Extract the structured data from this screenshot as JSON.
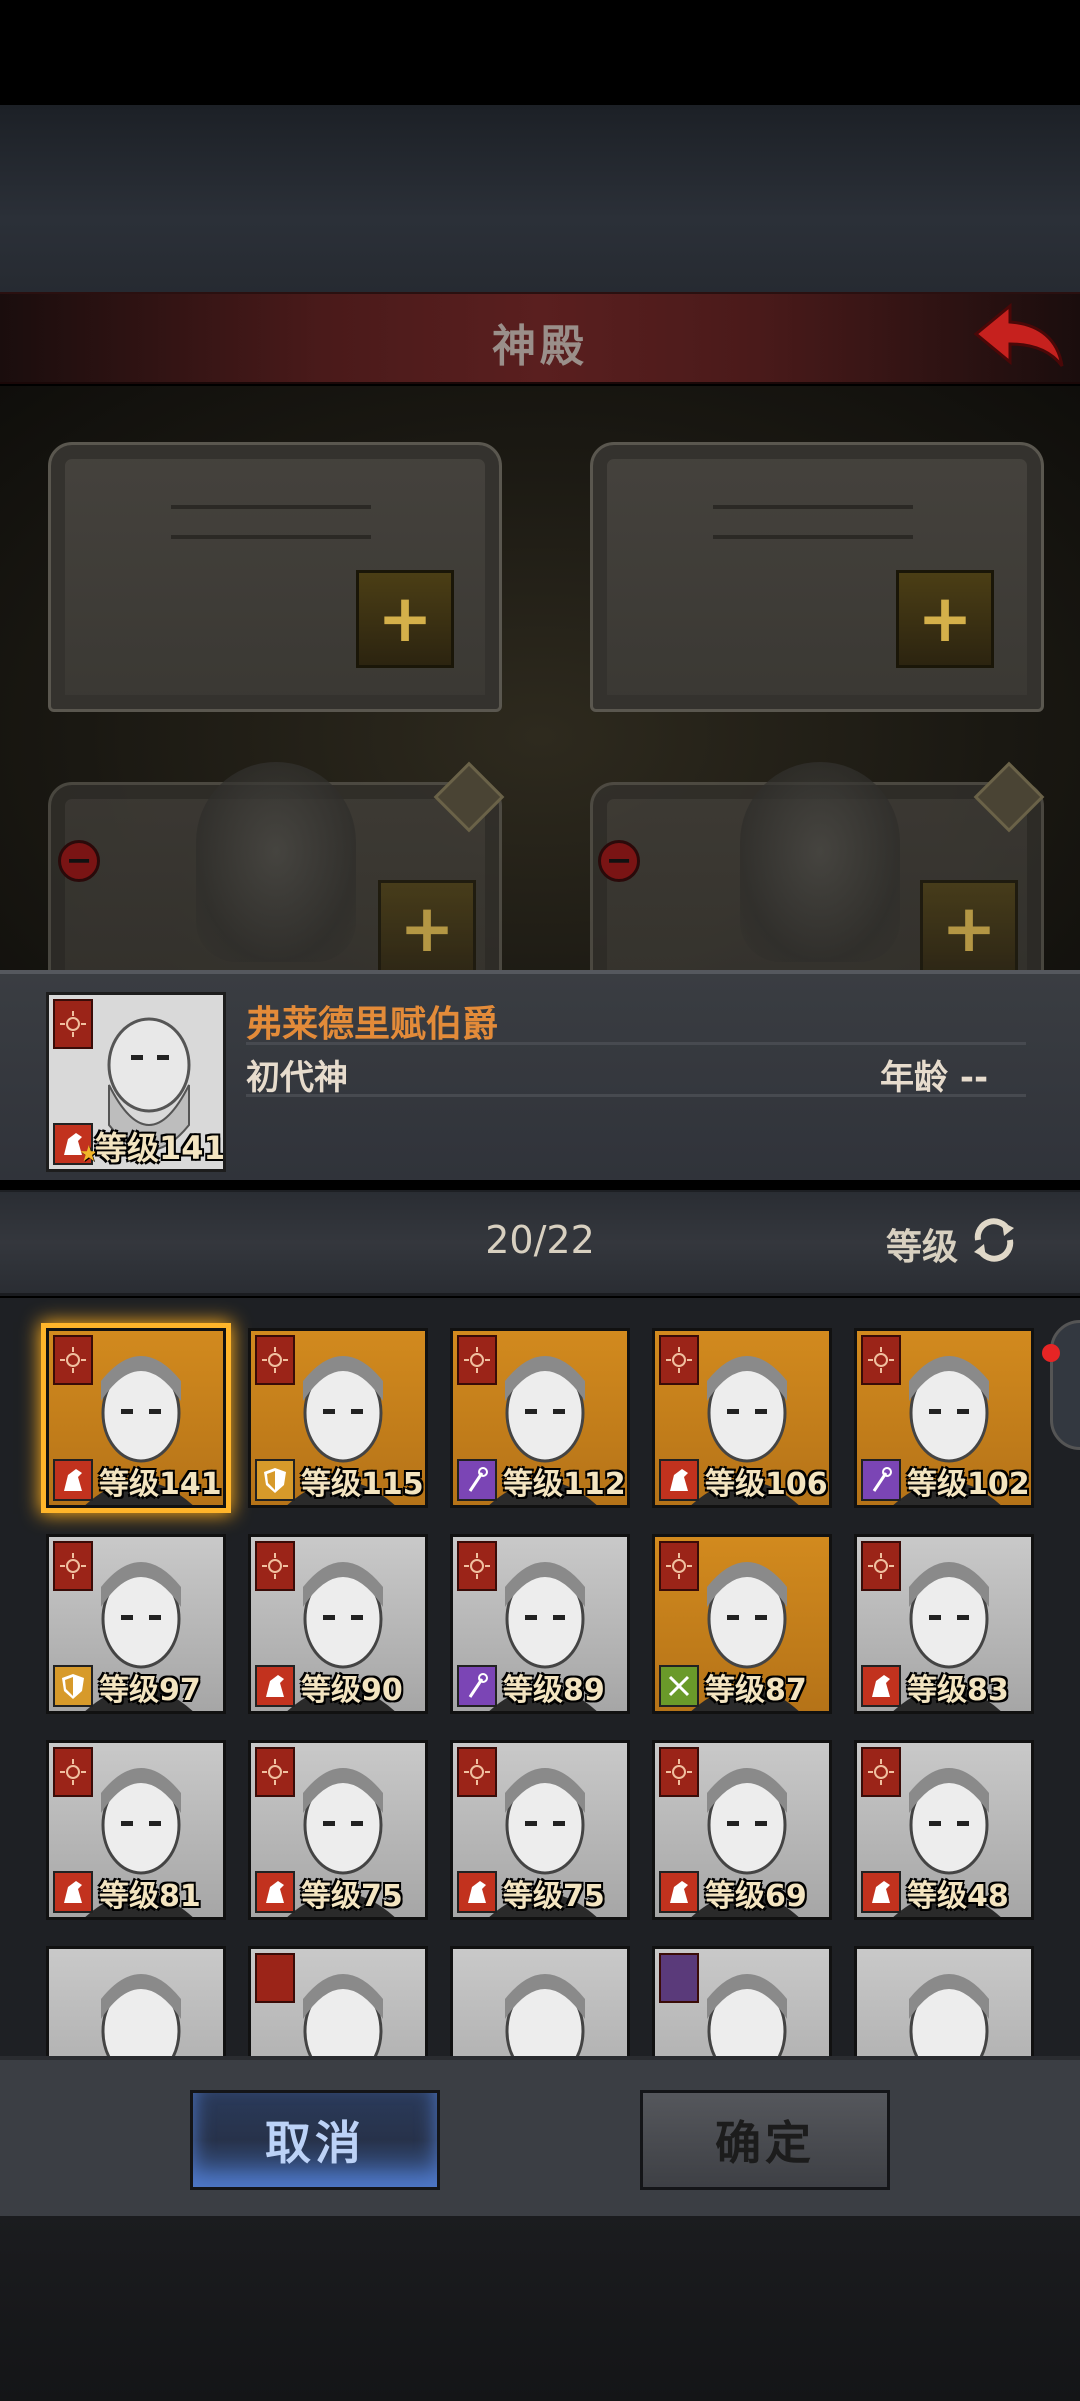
{
  "header": {
    "title": "神殿"
  },
  "selected_hero": {
    "name": "弗莱德里赋伯爵",
    "rank": "初代神",
    "age_label": "年龄 --",
    "level_label": "等级141"
  },
  "list_header": {
    "count": "20/22",
    "sort_label": "等级"
  },
  "heroes": [
    {
      "level": "等级141",
      "bg": "orange",
      "class": "horse",
      "selected": true
    },
    {
      "level": "等级115",
      "bg": "orange",
      "class": "shield"
    },
    {
      "level": "等级112",
      "bg": "orange",
      "class": "staff"
    },
    {
      "level": "等级106",
      "bg": "orange",
      "class": "horse"
    },
    {
      "level": "等级102",
      "bg": "orange",
      "class": "staff"
    },
    {
      "level": "等级97",
      "bg": "gray",
      "class": "shield"
    },
    {
      "level": "等级90",
      "bg": "gray",
      "class": "horse"
    },
    {
      "level": "等级89",
      "bg": "gray",
      "class": "staff"
    },
    {
      "level": "等级87",
      "bg": "orange",
      "class": "sword"
    },
    {
      "level": "等级83",
      "bg": "gray",
      "class": "horse"
    },
    {
      "level": "等级81",
      "bg": "gray",
      "class": "horse"
    },
    {
      "level": "等级75",
      "bg": "gray",
      "class": "horse"
    },
    {
      "level": "等级75",
      "bg": "gray",
      "class": "horse"
    },
    {
      "level": "等级69",
      "bg": "gray",
      "class": "horse"
    },
    {
      "level": "等级48",
      "bg": "gray",
      "class": "horse"
    }
  ],
  "buttons": {
    "cancel": "取消",
    "confirm": "确定"
  },
  "colors": {
    "accent_orange": "#e38b39",
    "banner_red": "#9b2418",
    "selected_glow": "#ffb52a"
  }
}
